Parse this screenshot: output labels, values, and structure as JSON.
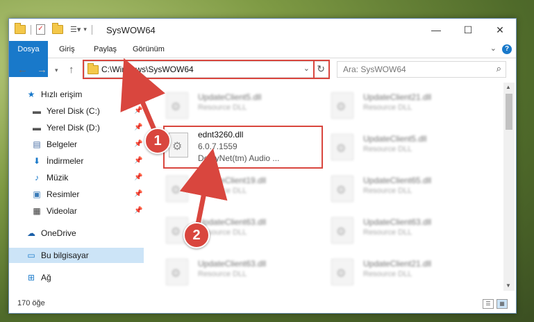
{
  "window": {
    "title": "SysWOW64",
    "controls": {
      "minimize": "—",
      "maximize": "☐",
      "close": "✕"
    }
  },
  "ribbon": {
    "tabs": [
      "Dosya",
      "Giriş",
      "Paylaş",
      "Görünüm"
    ],
    "help": "?"
  },
  "address": {
    "path": "C:\\Windows\\SysWOW64",
    "search_placeholder": "Ara: SysWOW64"
  },
  "sidebar": {
    "quick_access": "Hızlı erişim",
    "items": [
      {
        "label": "Yerel Disk (C:)",
        "icon": "drive-icon",
        "pinned": true
      },
      {
        "label": "Yerel Disk (D:)",
        "icon": "drive-icon",
        "pinned": true
      },
      {
        "label": "Belgeler",
        "icon": "documents-icon",
        "pinned": true
      },
      {
        "label": "İndirmeler",
        "icon": "download-icon",
        "pinned": true
      },
      {
        "label": "Müzik",
        "icon": "music-icon",
        "pinned": true
      },
      {
        "label": "Resimler",
        "icon": "pictures-icon",
        "pinned": true
      },
      {
        "label": "Videolar",
        "icon": "videos-icon",
        "pinned": true
      }
    ],
    "onedrive": "OneDrive",
    "this_pc": "Bu bilgisayar",
    "network": "Ağ"
  },
  "files": [
    {
      "name": "UpdateClient5.dll",
      "desc": "Resource DLL"
    },
    {
      "name": "UpdateClient21.dll",
      "desc": "Resource DLL"
    },
    {
      "name": "UpdateClient5.dll",
      "desc": "Resource DLL"
    },
    {
      "name": "UpdateClient19.dll",
      "desc": "Resource DLL"
    },
    {
      "name": "UpdateClient65.dll",
      "desc": "Resource DLL"
    },
    {
      "name": "UpdateClient63.dll",
      "desc": "Resource DLL"
    },
    {
      "name": "UpdateClient63.dll",
      "desc": "Resource DLL"
    },
    {
      "name": "UpdateClient63.dll",
      "desc": "Resource DLL"
    },
    {
      "name": "UpdateClient21.dll",
      "desc": "Resource DLL"
    }
  ],
  "highlighted_file": {
    "name": "ednt3260.dll",
    "version": "6.0.7.1559",
    "desc": "DolbyNet(tm) Audio ..."
  },
  "status": {
    "count": "170 öğe"
  },
  "annotations": {
    "step1": "1",
    "step2": "2",
    "color": "#d9463e"
  }
}
